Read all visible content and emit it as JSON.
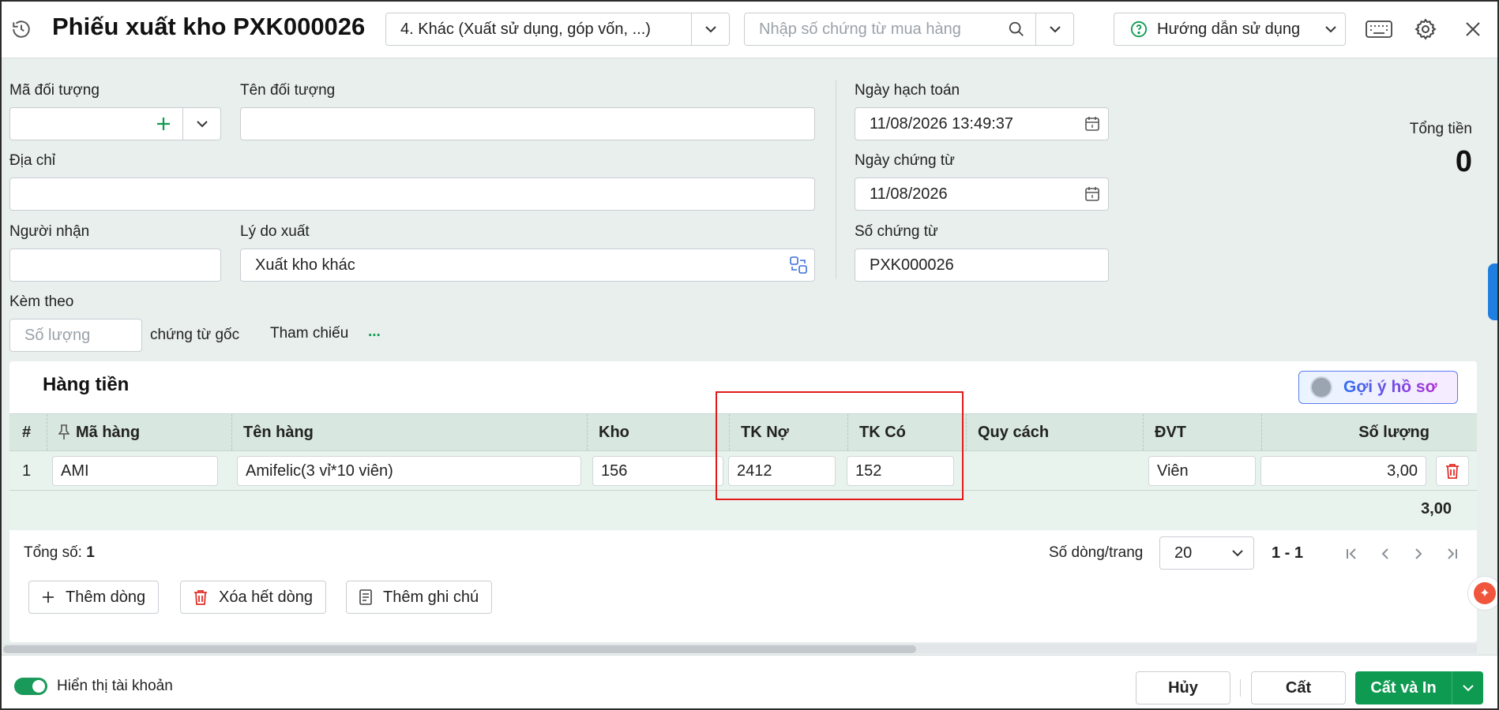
{
  "header": {
    "title": "Phiếu xuất kho PXK000026",
    "type_select": "4. Khác (Xuất sử dụng, góp vốn, ...)",
    "search_placeholder": "Nhập số chứng từ mua hàng",
    "help_label": "Hướng dẫn sử dụng",
    "icons": [
      "history-icon",
      "search-icon",
      "question-icon",
      "keyboard-icon",
      "gear-icon",
      "close-icon"
    ]
  },
  "form": {
    "ma_doi_tuong_label": "Mã đối tượng",
    "ma_doi_tuong_value": "",
    "ten_doi_tuong_label": "Tên đối tượng",
    "ten_doi_tuong_value": "",
    "dia_chi_label": "Địa chỉ",
    "dia_chi_value": "",
    "nguoi_nhan_label": "Người nhận",
    "nguoi_nhan_value": "",
    "ly_do_label": "Lý do xuất",
    "ly_do_value": "Xuất kho khác",
    "kem_theo_label": "Kèm theo",
    "so_luong_placeholder": "Số lượng",
    "chung_tu_goc": "chứng từ gốc",
    "tham_chieu": "Tham chiếu",
    "tham_chieu_more": "...",
    "ngay_hach_toan_label": "Ngày hạch toán",
    "ngay_hach_toan_value": "11/08/2026 13:49:37",
    "ngay_chung_tu_label": "Ngày chứng từ",
    "ngay_chung_tu_value": "11/08/2026",
    "so_chung_tu_label": "Số chứng từ",
    "so_chung_tu_value": "PXK000026",
    "tong_tien_label": "Tổng tiền",
    "tong_tien_value": "0"
  },
  "grid": {
    "title": "Hàng tiền",
    "suggest_label": "Gợi ý hồ sơ",
    "columns": [
      "#",
      "Mã hàng",
      "Tên hàng",
      "Kho",
      "TK Nợ",
      "TK Có",
      "Quy cách",
      "ĐVT",
      "Số lượng"
    ],
    "rows": [
      {
        "no": "1",
        "ma_hang": "AMI",
        "ten_hang": "Amifelic(3 vỉ*10 viên)",
        "kho": "156",
        "tk_no": "2412",
        "tk_co": "152",
        "quy_cach": "",
        "dvt": "Viên",
        "so_luong": "3,00"
      }
    ],
    "sum_so_luong": "3,00",
    "total_label": "Tổng số:",
    "total_value": "1",
    "rows_per_page_label": "Số dòng/trang",
    "rows_per_page": "20",
    "page_range": "1 - 1",
    "btn_add_row": "Thêm dòng",
    "btn_delete_all": "Xóa hết dòng",
    "btn_add_note": "Thêm ghi chú"
  },
  "footer": {
    "toggle_label": "Hiển thị tài khoản",
    "toggle_on": true,
    "cancel": "Hủy",
    "save": "Cất",
    "save_print": "Cất và In"
  },
  "colors": {
    "accent": "#0f9a52",
    "highlight_box": "#e11919",
    "header_row": "#d8e7e0"
  }
}
